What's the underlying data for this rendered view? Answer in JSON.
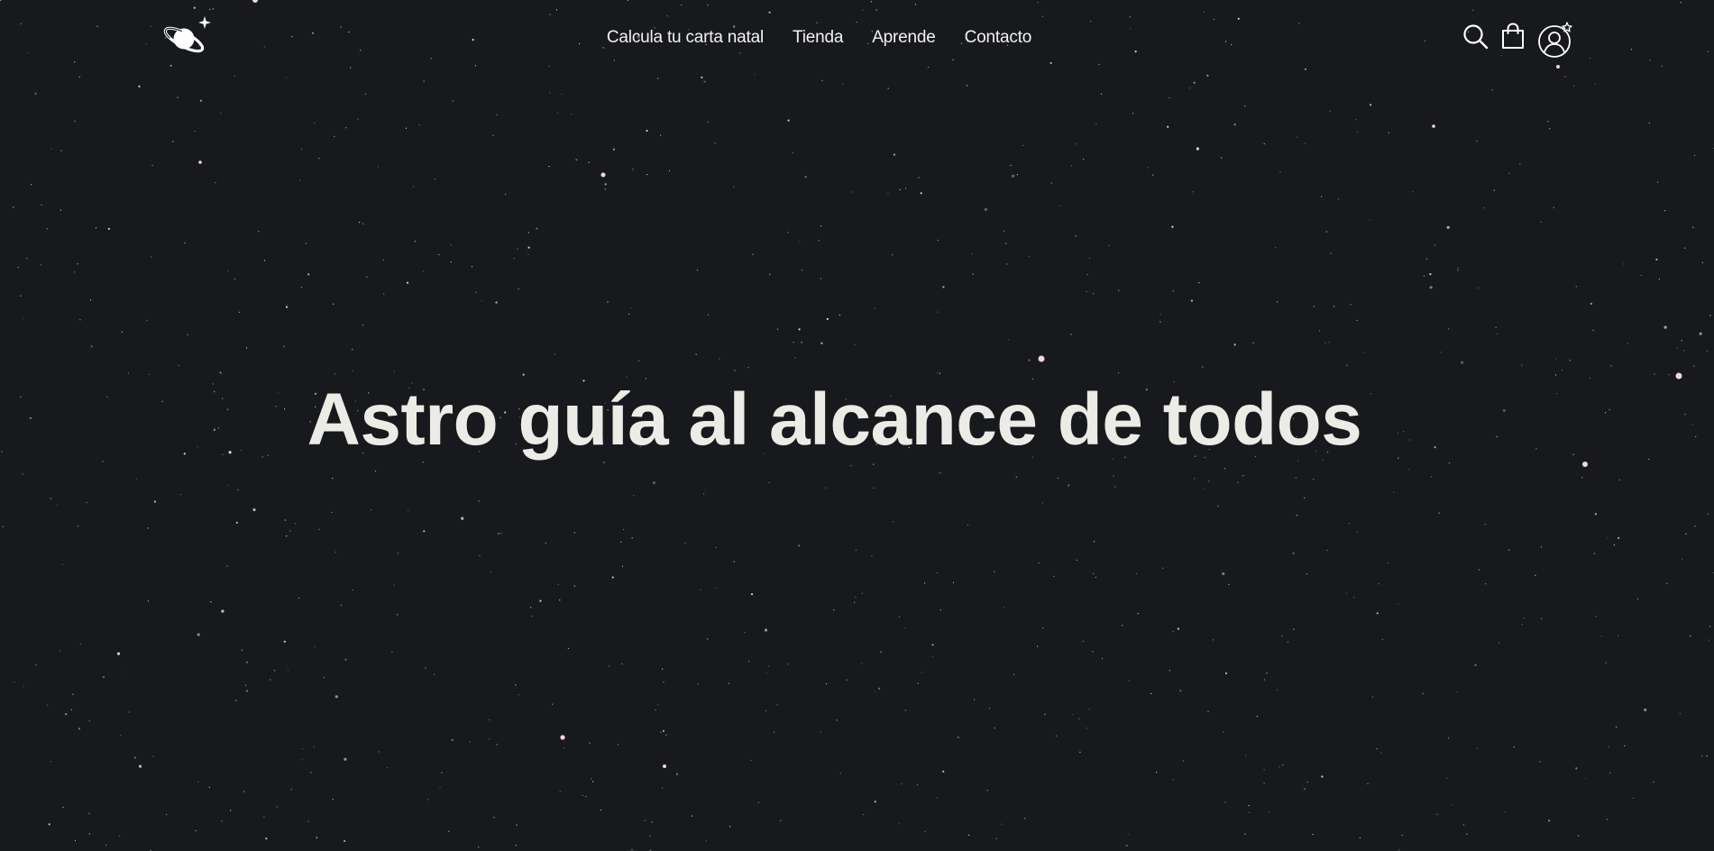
{
  "header": {
    "logo_icon": "saturn-sparkle-icon",
    "nav": [
      {
        "label": "Calcula tu carta natal"
      },
      {
        "label": "Tienda"
      },
      {
        "label": "Aprende"
      },
      {
        "label": "Contacto"
      }
    ],
    "actions": [
      {
        "icon": "search-icon"
      },
      {
        "icon": "shopping-bag-icon"
      },
      {
        "icon": "user-account-icon"
      }
    ]
  },
  "hero": {
    "title": "Astro guía al alcance de todos"
  },
  "colors": {
    "background": "#18191c",
    "text": "#ffffff",
    "hero_text": "#ecebe6",
    "star_white": "#ffffff",
    "star_pink": "#f0d6e0"
  }
}
